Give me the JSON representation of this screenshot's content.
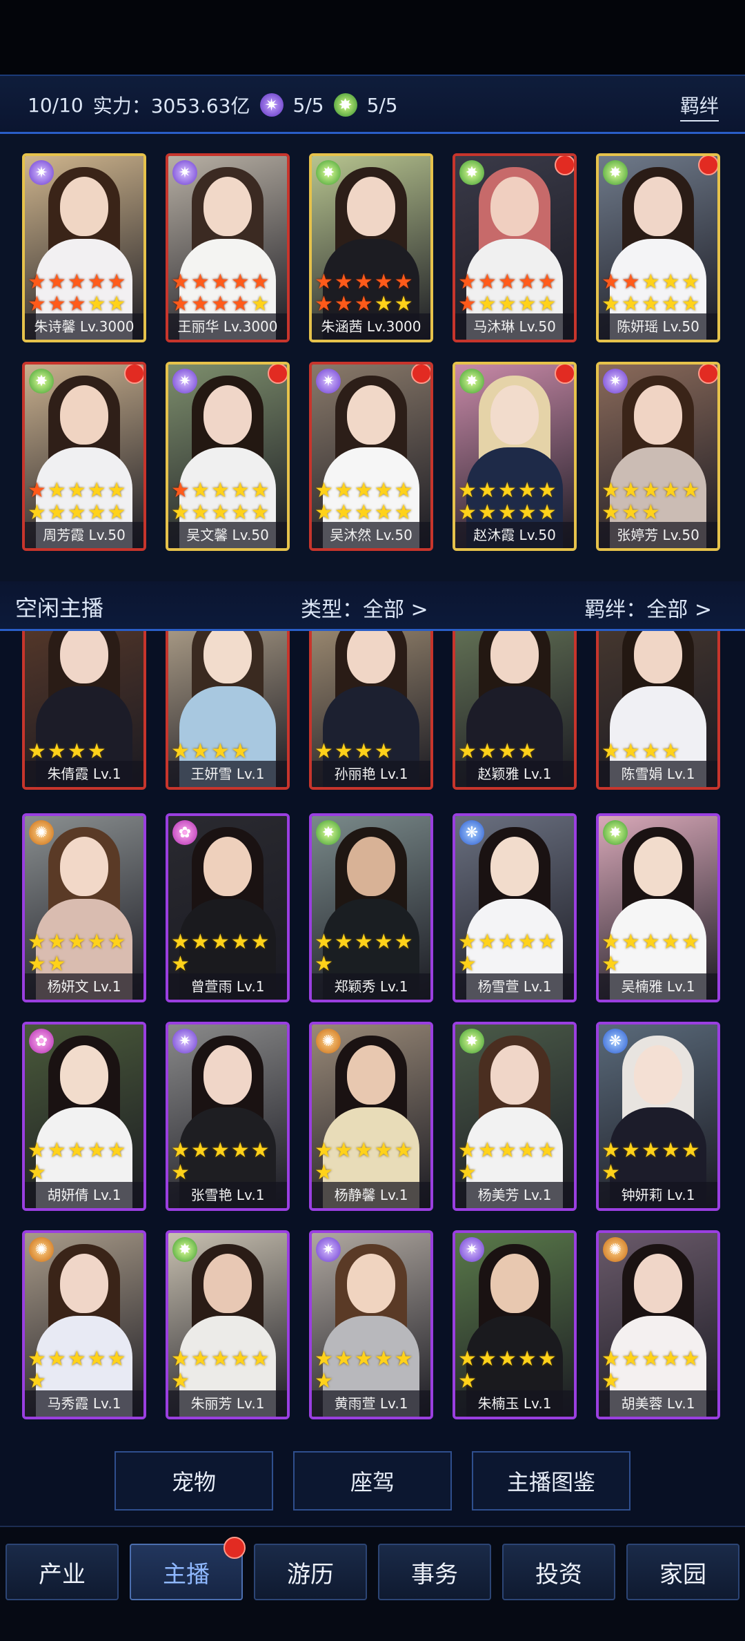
{
  "header": {
    "count": "10/10",
    "power_label": "实力：3053.63亿",
    "gem1_value": "5/5",
    "gem2_value": "5/5",
    "bond_button": "羁绊"
  },
  "active_cards": [
    {
      "name": "朱诗馨 Lv.3000",
      "border": "gold",
      "elem": "purple",
      "red_dot": false,
      "stars_red": 8,
      "stars_yellow": 2,
      "bg": "#cfb58d",
      "skin": "#f0d6c4",
      "hair": "#3a2418",
      "cloth": "#f2f0f2"
    },
    {
      "name": "王丽华 Lv.3000",
      "border": "red",
      "elem": "purple",
      "red_dot": false,
      "stars_red": 9,
      "stars_yellow": 1,
      "bg": "#b8b0a4",
      "skin": "#f1d8c8",
      "hair": "#3b2a22",
      "cloth": "#f4f4f2"
    },
    {
      "name": "朱涵茜 Lv.3000",
      "border": "gold",
      "elem": "green",
      "red_dot": false,
      "stars_red": 8,
      "stars_yellow": 2,
      "bg": "#b7c48f",
      "skin": "#f0d6c6",
      "hair": "#2c1e18",
      "cloth": "#1c1c22"
    },
    {
      "name": "马沐琳 Lv.50",
      "border": "red",
      "elem": "green",
      "red_dot": true,
      "stars_red": 6,
      "stars_yellow": 4,
      "bg": "#3a3a48",
      "skin": "#f0cfc0",
      "hair": "#c76a6a",
      "cloth": "#f0f0f0"
    },
    {
      "name": "陈妍瑶 Lv.50",
      "border": "gold",
      "elem": "green",
      "red_dot": true,
      "stars_red": 2,
      "stars_yellow": 8,
      "bg": "#6f7a8a",
      "skin": "#f0d6c8",
      "hair": "#2a1c16",
      "cloth": "#f4f4f6"
    },
    {
      "name": "周芳霞 Lv.50",
      "border": "red",
      "elem": "green",
      "red_dot": true,
      "stars_red": 1,
      "stars_yellow": 9,
      "bg": "#c9b08e",
      "skin": "#f0d4c2",
      "hair": "#2f1f18",
      "cloth": "#f0f0f2"
    },
    {
      "name": "吴文馨 Lv.50",
      "border": "gold",
      "elem": "purple",
      "red_dot": true,
      "stars_red": 1,
      "stars_yellow": 9,
      "bg": "#7d8e6c",
      "skin": "#f0d6c8",
      "hair": "#231812",
      "cloth": "#f0f0f0"
    },
    {
      "name": "吴沐然 Lv.50",
      "border": "red",
      "elem": "purple",
      "red_dot": true,
      "stars_red": 0,
      "stars_yellow": 10,
      "bg": "#8a7a6a",
      "skin": "#f1d8c8",
      "hair": "#2c1e18",
      "cloth": "#f6f6f6"
    },
    {
      "name": "赵沐霞 Lv.50",
      "border": "gold",
      "elem": "green",
      "red_dot": true,
      "stars_red": 0,
      "stars_yellow": 10,
      "bg": "#c98aa8",
      "skin": "#f2dccc",
      "hair": "#e5d3a8",
      "cloth": "#1e2a48"
    },
    {
      "name": "张婷芳 Lv.50",
      "border": "gold",
      "elem": "purple",
      "red_dot": true,
      "stars_red": 0,
      "stars_yellow": 8,
      "bg": "#8a6a5a",
      "skin": "#f0d4c4",
      "hair": "#3a2418",
      "cloth": "#cbbcb4"
    }
  ],
  "idle_bar": {
    "title": "空闲主播",
    "type_filter": "类型：全部 >",
    "bond_filter": "羁绊：全部 >"
  },
  "idle_cards": [
    {
      "name": "朱倩霞 Lv.1",
      "border": "red",
      "elem": "",
      "stars_yellow": 4,
      "bg": "#5a3a2a",
      "skin": "#f0d6c8",
      "hair": "#2a1c16",
      "cloth": "#1c1c28"
    },
    {
      "name": "王妍雪 Lv.1",
      "border": "red",
      "elem": "",
      "stars_yellow": 4,
      "bg": "#b8a890",
      "skin": "#f2dccc",
      "hair": "#3a2a20",
      "cloth": "#a8c8e0"
    },
    {
      "name": "孙丽艳 Lv.1",
      "border": "red",
      "elem": "",
      "stars_yellow": 4,
      "bg": "#a89478",
      "skin": "#f0d6c6",
      "hair": "#2a1c16",
      "cloth": "#1c2030"
    },
    {
      "name": "赵颖雅 Lv.1",
      "border": "red",
      "elem": "",
      "stars_yellow": 4,
      "bg": "#6a7a5a",
      "skin": "#f0d6c6",
      "hair": "#231812",
      "cloth": "#1c1c28"
    },
    {
      "name": "陈雪娟 Lv.1",
      "border": "red",
      "elem": "",
      "stars_yellow": 4,
      "bg": "#4a3a30",
      "skin": "#f0d6c6",
      "hair": "#231812",
      "cloth": "#f0f0f4"
    },
    {
      "name": "杨妍文 Lv.1",
      "border": "purple",
      "elem": "orange",
      "stars_yellow": 7,
      "bg": "#8a8f90",
      "skin": "#f2d8c8",
      "hair": "#5a3a26",
      "cloth": "#d9bcb0"
    },
    {
      "name": "曾萱雨 Lv.1",
      "border": "purple",
      "elem": "magenta",
      "stars_yellow": 6,
      "bg": "#2a2a30",
      "skin": "#eed0bc",
      "hair": "#1a1212",
      "cloth": "#1a1a1e"
    },
    {
      "name": "郑颖秀 Lv.1",
      "border": "purple",
      "elem": "green",
      "stars_yellow": 6,
      "bg": "#7a8a8a",
      "skin": "#d8b296",
      "hair": "#1e1612",
      "cloth": "#1a1e22"
    },
    {
      "name": "杨雪萱 Lv.1",
      "border": "purple",
      "elem": "blue",
      "stars_yellow": 6,
      "bg": "#6a7080",
      "skin": "#f2dccc",
      "hair": "#1a1212",
      "cloth": "#f4f4f6"
    },
    {
      "name": "吴楠雅 Lv.1",
      "border": "purple",
      "elem": "green",
      "stars_yellow": 6,
      "bg": "#d8a8b8",
      "skin": "#f2dccc",
      "hair": "#1a1212",
      "cloth": "#f6f6f6"
    },
    {
      "name": "胡妍倩 Lv.1",
      "border": "purple",
      "elem": "magenta",
      "stars_yellow": 6,
      "bg": "#4a5a3a",
      "skin": "#f2dccc",
      "hair": "#1a1212",
      "cloth": "#f2f2f2"
    },
    {
      "name": "张雪艳 Lv.1",
      "border": "purple",
      "elem": "purple",
      "stars_yellow": 6,
      "bg": "#8a8a8a",
      "skin": "#f0d6c8",
      "hair": "#1a1212",
      "cloth": "#1e1e22"
    },
    {
      "name": "杨静馨 Lv.1",
      "border": "purple",
      "elem": "orange",
      "stars_yellow": 6,
      "bg": "#9a8a78",
      "skin": "#e8c8b0",
      "hair": "#1a1212",
      "cloth": "#e8dcb8"
    },
    {
      "name": "杨美芳 Lv.1",
      "border": "purple",
      "elem": "green",
      "stars_yellow": 6,
      "bg": "#4a5a48",
      "skin": "#f0d6c8",
      "hair": "#4a2e20",
      "cloth": "#f2f2f2"
    },
    {
      "name": "钟妍莉 Lv.1",
      "border": "purple",
      "elem": "blue",
      "stars_yellow": 6,
      "bg": "#5a6a7a",
      "skin": "#f4e0d4",
      "hair": "#e8e4e0",
      "cloth": "#1c1c2a"
    },
    {
      "name": "马秀霞 Lv.1",
      "border": "purple",
      "elem": "orange",
      "stars_yellow": 6,
      "bg": "#a89a88",
      "skin": "#f0d6c8",
      "hair": "#3a2418",
      "cloth": "#e8eaf4"
    },
    {
      "name": "朱丽芳 Lv.1",
      "border": "purple",
      "elem": "green",
      "stars_yellow": 6,
      "bg": "#c8c0b0",
      "skin": "#e8c8b4",
      "hair": "#2a1c16",
      "cloth": "#ecebe8"
    },
    {
      "name": "黄雨萱 Lv.1",
      "border": "purple",
      "elem": "purple",
      "stars_yellow": 6,
      "bg": "#b0a8a0",
      "skin": "#f0d4c0",
      "hair": "#5a3a26",
      "cloth": "#b8b8bc"
    },
    {
      "name": "朱楠玉 Lv.1",
      "border": "purple",
      "elem": "purple",
      "stars_yellow": 6,
      "bg": "#5a7a4a",
      "skin": "#e8c8b0",
      "hair": "#1a1212",
      "cloth": "#1a1a1e"
    },
    {
      "name": "胡美蓉 Lv.1",
      "border": "purple",
      "elem": "orange",
      "stars_yellow": 6,
      "bg": "#6a5a6a",
      "skin": "#f0d6c8",
      "hair": "#1a1212",
      "cloth": "#f4f0f0"
    }
  ],
  "buttons": [
    "宠物",
    "座驾",
    "主播图鉴"
  ],
  "nav": [
    {
      "label": "产业",
      "active": false,
      "dot": false
    },
    {
      "label": "主播",
      "active": true,
      "dot": true
    },
    {
      "label": "游历",
      "active": false,
      "dot": false
    },
    {
      "label": "事务",
      "active": false,
      "dot": false
    },
    {
      "label": "投资",
      "active": false,
      "dot": false
    },
    {
      "label": "家园",
      "active": false,
      "dot": false
    }
  ],
  "colors": {
    "accent": "#2a5ec7",
    "red_dot": "#e22b22",
    "star_yellow": "#ffd21a",
    "star_red": "#ff5a1a"
  }
}
